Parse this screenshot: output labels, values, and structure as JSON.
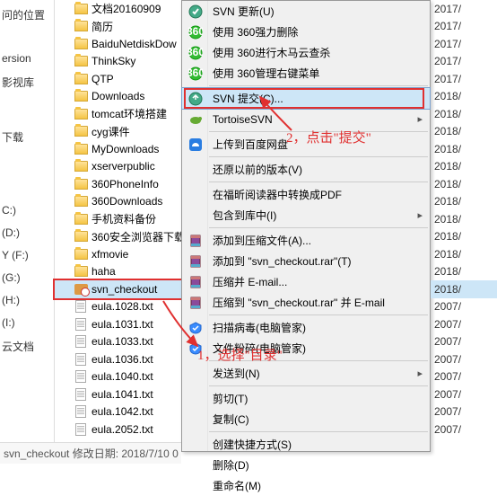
{
  "leftPane": [
    "问的位置",
    "",
    "",
    "ersion",
    "影视库",
    "",
    "",
    "",
    "下载",
    "",
    "",
    "",
    "",
    "",
    "C:)",
    "(D:)",
    "Y (F:)",
    "(G:)",
    "(H:)",
    "(I:)",
    "云文档"
  ],
  "files": [
    {
      "name": "文档20160909",
      "type": "folder"
    },
    {
      "name": "简历",
      "type": "folder"
    },
    {
      "name": "BaiduNetdiskDow",
      "type": "folder"
    },
    {
      "name": "ThinkSky",
      "type": "folder"
    },
    {
      "name": "QTP",
      "type": "folder"
    },
    {
      "name": "Downloads",
      "type": "folder"
    },
    {
      "name": "tomcat环境搭建",
      "type": "folder"
    },
    {
      "name": "cyg课件",
      "type": "folder"
    },
    {
      "name": "MyDownloads",
      "type": "folder"
    },
    {
      "name": "xserverpublic",
      "type": "folder"
    },
    {
      "name": "360PhoneInfo",
      "type": "folder"
    },
    {
      "name": "360Downloads",
      "type": "folder"
    },
    {
      "name": "手机资料备份",
      "type": "folder"
    },
    {
      "name": "360安全浏览器下载",
      "type": "folder"
    },
    {
      "name": "xfmovie",
      "type": "folder"
    },
    {
      "name": "haha",
      "type": "folder"
    },
    {
      "name": "svn_checkout",
      "type": "svn"
    },
    {
      "name": "eula.1028.txt",
      "type": "file"
    },
    {
      "name": "eula.1031.txt",
      "type": "file"
    },
    {
      "name": "eula.1033.txt",
      "type": "file"
    },
    {
      "name": "eula.1036.txt",
      "type": "file"
    },
    {
      "name": "eula.1040.txt",
      "type": "file"
    },
    {
      "name": "eula.1041.txt",
      "type": "file"
    },
    {
      "name": "eula.1042.txt",
      "type": "file"
    },
    {
      "name": "eula.2052.txt",
      "type": "file"
    }
  ],
  "menu": [
    {
      "type": "item",
      "label": "SVN 更新(U)",
      "icon": "svn",
      "sub": false
    },
    {
      "type": "item",
      "label": "使用 360强力删除",
      "icon": "g360",
      "sub": false
    },
    {
      "type": "item",
      "label": "使用 360进行木马云查杀",
      "icon": "g360",
      "sub": false
    },
    {
      "type": "item",
      "label": "使用 360管理右键菜单",
      "icon": "g360",
      "sub": false
    },
    {
      "type": "sep"
    },
    {
      "type": "item",
      "label": "SVN 提交(C)...",
      "icon": "svncommit",
      "sub": false,
      "hover": true,
      "redbox": true
    },
    {
      "type": "item",
      "label": "TortoiseSVN",
      "icon": "tortoise",
      "sub": true
    },
    {
      "type": "sep"
    },
    {
      "type": "item",
      "label": "上传到百度网盘",
      "icon": "baidu",
      "sub": false
    },
    {
      "type": "sep"
    },
    {
      "type": "item",
      "label": "还原以前的版本(V)",
      "icon": "",
      "sub": false
    },
    {
      "type": "sep"
    },
    {
      "type": "item",
      "label": "在福昕阅读器中转换成PDF",
      "icon": "",
      "sub": false
    },
    {
      "type": "item",
      "label": "包含到库中(I)",
      "icon": "",
      "sub": true
    },
    {
      "type": "sep"
    },
    {
      "type": "item",
      "label": "添加到压缩文件(A)...",
      "icon": "rar",
      "sub": false
    },
    {
      "type": "item",
      "label": "添加到 \"svn_checkout.rar\"(T)",
      "icon": "rar",
      "sub": false
    },
    {
      "type": "item",
      "label": "压缩并 E-mail...",
      "icon": "rar",
      "sub": false
    },
    {
      "type": "item",
      "label": "压缩到 \"svn_checkout.rar\" 并 E-mail",
      "icon": "rar",
      "sub": false
    },
    {
      "type": "sep"
    },
    {
      "type": "item",
      "label": "扫描病毒(电脑管家)",
      "icon": "qq",
      "sub": false
    },
    {
      "type": "item",
      "label": "文件粉碎(电脑管家)",
      "icon": "qq",
      "sub": false
    },
    {
      "type": "sep"
    },
    {
      "type": "item",
      "label": "发送到(N)",
      "icon": "",
      "sub": true
    },
    {
      "type": "sep"
    },
    {
      "type": "item",
      "label": "剪切(T)",
      "icon": "",
      "sub": false
    },
    {
      "type": "item",
      "label": "复制(C)",
      "icon": "",
      "sub": false
    },
    {
      "type": "sep"
    },
    {
      "type": "item",
      "label": "创建快捷方式(S)",
      "icon": "",
      "sub": false
    },
    {
      "type": "item",
      "label": "删除(D)",
      "icon": "",
      "sub": false
    },
    {
      "type": "item",
      "label": "重命名(M)",
      "icon": "",
      "sub": false
    }
  ],
  "dates": [
    "2017/",
    "2017/",
    "2017/",
    "2017/",
    "2017/",
    "2018/",
    "2018/",
    "2018/",
    "2018/",
    "2018/",
    "2018/",
    "2018/",
    "2018/",
    "2018/",
    "2018/",
    "2018/",
    "2018/",
    "2007/",
    "2007/",
    "2007/",
    "2007/",
    "2007/",
    "2007/",
    "2007/",
    "2007/"
  ],
  "selectedIndex": 16,
  "statusBar": "svn_checkout 修改日期: 2018/7/10 0",
  "anno1": "2，点击\"提交\"",
  "anno2": "1，选择\"目录\""
}
